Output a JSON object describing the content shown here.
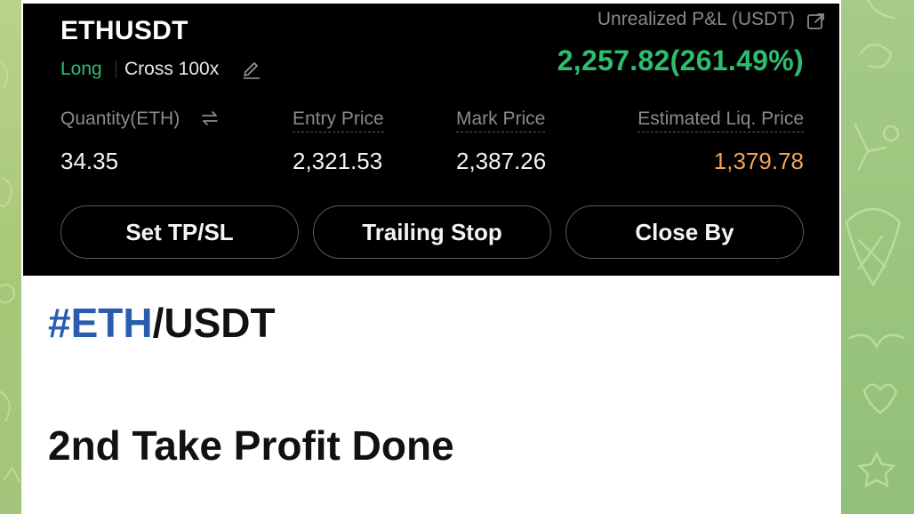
{
  "position": {
    "symbol": "ETHUSDT",
    "side": "Long",
    "margin_mode": "Cross 100x",
    "pnl_label": "Unrealized P&L (USDT)",
    "pnl_value": "2,257.82(261.49%)",
    "columns": [
      {
        "label": "Quantity(ETH)",
        "value": "34.35"
      },
      {
        "label": "Entry Price",
        "value": "2,321.53"
      },
      {
        "label": "Mark Price",
        "value": "2,387.26"
      },
      {
        "label": "Estimated Liq. Price",
        "value": "1,379.78"
      }
    ],
    "buttons": [
      "Set TP/SL",
      "Trailing Stop",
      "Close By"
    ],
    "icons": {
      "edit": "pencil-icon",
      "share": "share-icon",
      "swap": "swap-icon"
    },
    "colors": {
      "profit_green": "#2ebd6e",
      "liq_orange": "#f0a35c",
      "hashtag_blue": "#2a5db0"
    }
  },
  "message": {
    "hashtag": "#ETH",
    "pair_suffix": "/USDT",
    "text": "2nd Take Profit Done"
  }
}
